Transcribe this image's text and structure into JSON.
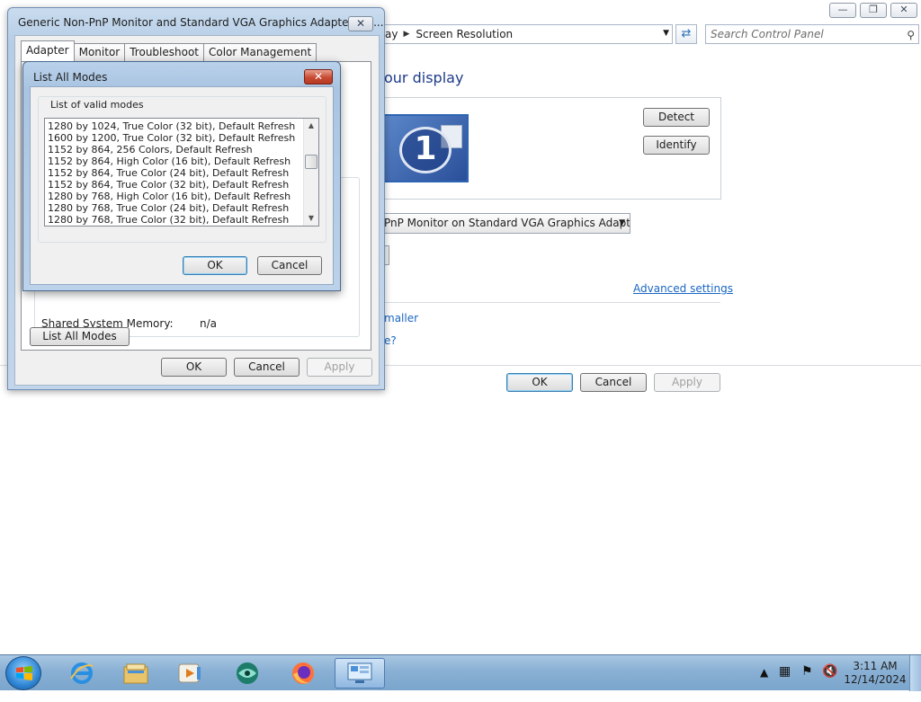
{
  "control_panel": {
    "breadcrumb_partial": "ay",
    "breadcrumb_current": "Screen Resolution",
    "search_placeholder": "Search Control Panel",
    "headline_partial": "our display",
    "detect_label": "Detect",
    "identify_label": "Identify",
    "monitor_number": "1",
    "display_select_value": "PnP Monitor on Standard VGA Graphics Adapter",
    "advanced_settings_link": "Advanced settings",
    "link_smaller_partial": "maller",
    "link_question_partial": "e?",
    "ok_label": "OK",
    "cancel_label": "Cancel",
    "apply_label": "Apply"
  },
  "properties_dialog": {
    "title": "Generic Non-PnP Monitor and Standard VGA Graphics Adapter Pro...",
    "tabs": [
      "Adapter",
      "Monitor",
      "Troubleshoot",
      "Color Management"
    ],
    "shared_memory_label": "Shared System Memory:",
    "shared_memory_value": "n/a",
    "list_all_modes_label": "List All Modes",
    "ok_label": "OK",
    "cancel_label": "Cancel",
    "apply_label": "Apply"
  },
  "modes_dialog": {
    "title": "List All Modes",
    "group_label": "List of valid modes",
    "modes": [
      "1280 by 1024, True Color (32 bit), Default Refresh",
      "1600 by 1200, True Color (32 bit), Default Refresh",
      "1152 by 864, 256 Colors, Default Refresh",
      "1152 by 864, High Color (16 bit), Default Refresh",
      "1152 by 864, True Color (24 bit), Default Refresh",
      "1152 by 864, True Color (32 bit), Default Refresh",
      "1280 by 768, High Color (16 bit), Default Refresh",
      "1280 by 768, True Color (24 bit), Default Refresh",
      "1280 by 768, True Color (32 bit), Default Refresh"
    ],
    "ok_label": "OK",
    "cancel_label": "Cancel"
  },
  "taskbar": {
    "pinned": [
      "internet-explorer-icon",
      "file-explorer-icon",
      "media-player-icon",
      "app-icon",
      "firefox-icon",
      "control-panel-icon"
    ],
    "time": "3:11 AM",
    "date": "12/14/2024"
  }
}
